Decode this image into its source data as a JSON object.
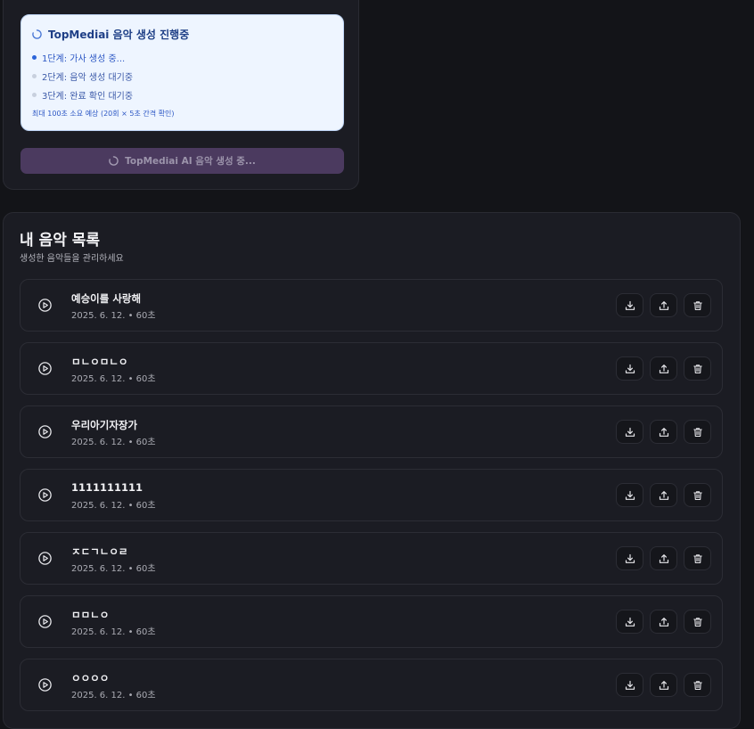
{
  "generation": {
    "progress_title": "TopMediai 음악 생성 진행중",
    "steps": [
      {
        "label": "1단계: 가사 생성 중...",
        "state": "active"
      },
      {
        "label": "2단계: 음악 생성 대기중",
        "state": "pending"
      },
      {
        "label": "3단계: 완료 확인 대기중",
        "state": "pending"
      }
    ],
    "note": "최대 100초 소요 예상 (20회 × 5초 간격 확인)",
    "button_label": "TopMediai AI 음악 생성 중..."
  },
  "library": {
    "title": "내 음악 목록",
    "subtitle": "생성한 음악들을 관리하세요",
    "tracks": [
      {
        "title": "예승이를 사랑해",
        "meta": "2025. 6. 12. • 60초"
      },
      {
        "title": "ㅁㄴㅇㅁㄴㅇ",
        "meta": "2025. 6. 12. • 60초"
      },
      {
        "title": "우리아기자장가",
        "meta": "2025. 6. 12. • 60초"
      },
      {
        "title": "1111111111",
        "meta": "2025. 6. 12. • 60초"
      },
      {
        "title": "ㅈㄷㄱㄴㅇㄹ",
        "meta": "2025. 6. 12. • 60초"
      },
      {
        "title": "ㅁㅁㄴㅇ",
        "meta": "2025. 6. 12. • 60초"
      },
      {
        "title": "ㅇㅇㅇㅇ",
        "meta": "2025. 6. 12. • 60초"
      }
    ],
    "action_icons": [
      "download-icon",
      "share-icon",
      "trash-icon"
    ]
  },
  "colors": {
    "background": "#131418",
    "card": "#1b1c23",
    "progress_bg": "#eef5ff",
    "accent_blue": "#2c64d8",
    "button_purple": "#4b3a5f"
  }
}
